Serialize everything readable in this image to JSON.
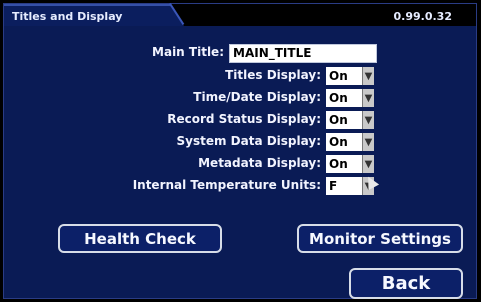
{
  "header": {
    "title": "Titles and Display",
    "version": "0.99.0.32"
  },
  "main_title": {
    "label": "Main Title:",
    "value": "MAIN_TITLE"
  },
  "settings": [
    {
      "label": "Titles Display:",
      "value": "On"
    },
    {
      "label": "Time/Date Display:",
      "value": "On"
    },
    {
      "label": "Record Status Display:",
      "value": "On"
    },
    {
      "label": "System Data Display:",
      "value": "On"
    },
    {
      "label": "Metadata Display:",
      "value": "On"
    },
    {
      "label": "Internal Temperature Units:",
      "value": "F"
    }
  ],
  "buttons": {
    "health_check": "Health Check",
    "monitor_settings": "Monitor Settings",
    "back": "Back"
  },
  "icons": {
    "dropdown": "dropdown-arrow-icon",
    "pointer": "mouse-pointer-icon"
  },
  "colors": {
    "background": "#0a1b55",
    "button_border": "#d7dde8"
  }
}
